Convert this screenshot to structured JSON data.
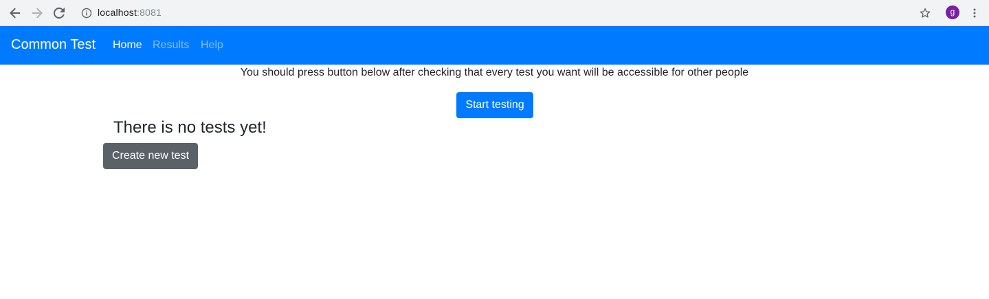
{
  "browser": {
    "url_host": "localhost",
    "url_port": ":8081",
    "avatar_letter": "g",
    "icons": [
      "back-arrow-icon",
      "forward-arrow-icon",
      "reload-icon",
      "info-icon",
      "star-icon",
      "kebab-menu-icon"
    ]
  },
  "navbar": {
    "brand": "Common Test",
    "links": [
      {
        "label": "Home",
        "active": true
      },
      {
        "label": "Results",
        "active": false
      },
      {
        "label": "Help",
        "active": false
      }
    ]
  },
  "main": {
    "notice": "You should press button below after checking that every test you want will be accessible for other people",
    "start_button": "Start testing",
    "empty_message": "There is no tests yet!",
    "create_button": "Create new test"
  },
  "colors": {
    "primary": "#007bff",
    "secondary": "#5a6268",
    "text": "#212529",
    "avatar": "#7b1fa2"
  }
}
